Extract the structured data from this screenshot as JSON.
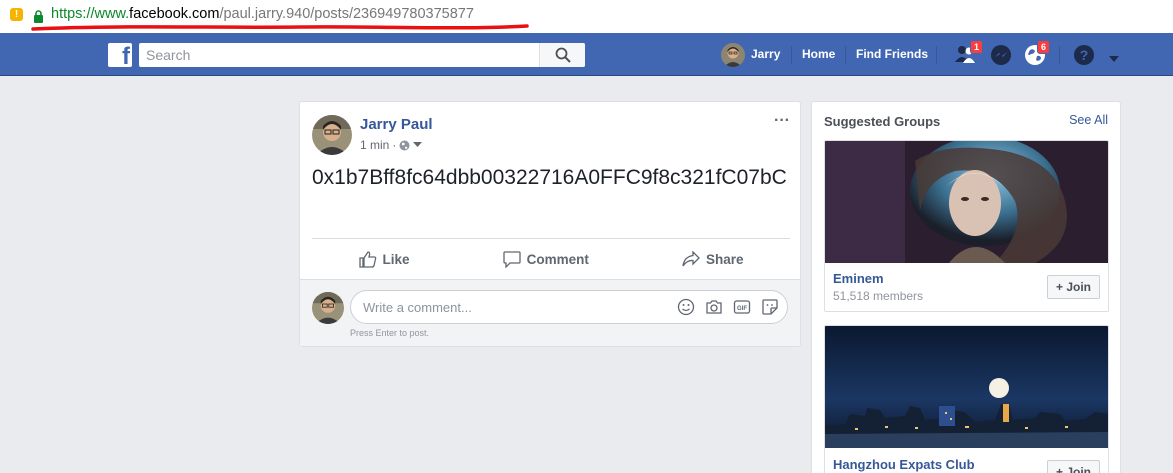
{
  "browser": {
    "url_scheme": "https://www.",
    "url_host": "facebook.com",
    "url_path": "/paul.jarry.940/posts/236949780375877"
  },
  "topbar": {
    "search_placeholder": "Search",
    "user_name": "Jarry",
    "nav_home": "Home",
    "nav_find_friends": "Find Friends",
    "friend_requests_count": "1",
    "notifications_count": "6",
    "brand_color": "#4267b2"
  },
  "post": {
    "author": "Jarry Paul",
    "time": "1 min",
    "content": "0x1b7Bff8fc64dbb00322716A0FFC9f8c321fC07bC",
    "like_label": "Like",
    "comment_label": "Comment",
    "share_label": "Share",
    "comment_placeholder": "Write a comment...",
    "comment_hint": "Press Enter to post."
  },
  "suggested_groups": {
    "title": "Suggested Groups",
    "see_all": "See All",
    "groups": [
      {
        "name": "Eminem",
        "members": "51,518 members",
        "join_label": "Join"
      },
      {
        "name": "Hangzhou Expats Club",
        "members": "",
        "join_label": "Join"
      }
    ]
  }
}
